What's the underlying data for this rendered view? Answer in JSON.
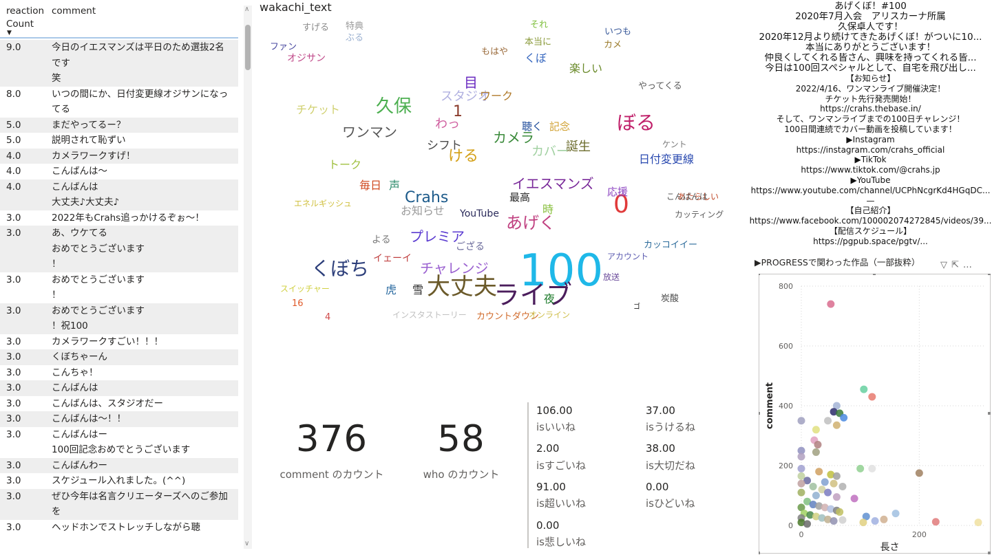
{
  "table": {
    "headers": {
      "reaction_count": "reaction Count",
      "comment": "comment"
    },
    "rows": [
      {
        "count": "9.0",
        "comment": "今日のイエスマンズは平日のため選抜2名です\n笑"
      },
      {
        "count": "8.0",
        "comment": "いつの間にか、日付変更線オジサンになってる"
      },
      {
        "count": "5.0",
        "comment": "まだやってるー？"
      },
      {
        "count": "5.0",
        "comment": "説明されて恥ずい"
      },
      {
        "count": "4.0",
        "comment": "カメラワークすげ！"
      },
      {
        "count": "4.0",
        "comment": "こんばんは〜"
      },
      {
        "count": "4.0",
        "comment": "こんばんは\n大丈夫♪大丈夫♪"
      },
      {
        "count": "3.0",
        "comment": "2022年もCrahs追っかけるぞぉ〜！"
      },
      {
        "count": "3.0",
        "comment": "あ、ウケてる\nおめでとうございます\n！"
      },
      {
        "count": "3.0",
        "comment": "おめでとうございます\n！"
      },
      {
        "count": "3.0",
        "comment": "おめでとうございます\n！祝100"
      },
      {
        "count": "3.0",
        "comment": "カメラワークすごい！！！"
      },
      {
        "count": "3.0",
        "comment": "くぼちゃーん"
      },
      {
        "count": "3.0",
        "comment": "こんちゃ！"
      },
      {
        "count": "3.0",
        "comment": "こんばんは"
      },
      {
        "count": "3.0",
        "comment": "こんばんは、スタジオだー"
      },
      {
        "count": "3.0",
        "comment": "こんばんは〜！！"
      },
      {
        "count": "3.0",
        "comment": "こんばんはー\n100回記念おめでとうございます"
      },
      {
        "count": "3.0",
        "comment": "こんばんわー"
      },
      {
        "count": "3.0",
        "comment": "スケジュール入れました。(^^)"
      },
      {
        "count": "3.0",
        "comment": "ぜひ今年は名言クリエーターズへのご参加を"
      },
      {
        "count": "3.0",
        "comment": "ヘッドホンでストレッチしながら聴"
      }
    ]
  },
  "wordcloud": {
    "title": "wakachi_text",
    "words": [
      {
        "text": "100",
        "color": "#1fb8e8",
        "size": 64
      },
      {
        "text": "ライブ",
        "color": "#4b1d5c",
        "size": 38
      },
      {
        "text": "大丈夫",
        "color": "#6b5a2a",
        "size": 34
      },
      {
        "text": "0",
        "color": "#e03a3a",
        "size": 36
      },
      {
        "text": "くぼち",
        "color": "#2c3e7a",
        "size": 28
      },
      {
        "text": "ぼる",
        "color": "#c0206a",
        "size": 28
      },
      {
        "text": "久保",
        "color": "#4caf50",
        "size": 26
      },
      {
        "text": "あげく",
        "color": "#c04080",
        "size": 24
      },
      {
        "text": "Crahs",
        "color": "#1c5a8a",
        "size": 22
      },
      {
        "text": "ける",
        "color": "#d4a017",
        "size": 22
      },
      {
        "text": "カメラ",
        "color": "#3a8a3a",
        "size": 20
      },
      {
        "text": "イエスマンズ",
        "color": "#7a2a9a",
        "size": 20
      },
      {
        "text": "プレミア",
        "color": "#5a3ad0",
        "size": 20
      },
      {
        "text": "チャレンジ",
        "color": "#9a60d0",
        "size": 20
      },
      {
        "text": "ワンマン",
        "color": "#555555",
        "size": 20
      },
      {
        "text": "1",
        "color": "#8a3a2a",
        "size": 22
      },
      {
        "text": "わっ",
        "color": "#d060a0",
        "size": 18
      },
      {
        "text": "目",
        "color": "#6a2ac0",
        "size": 20
      },
      {
        "text": "日付変更線",
        "color": "#2a4ab0",
        "size": 16
      },
      {
        "text": "スタジオ",
        "color": "#b0b0e0",
        "size": 18
      },
      {
        "text": "誕生",
        "color": "#6a6a2a",
        "size": 18
      },
      {
        "text": "カバー",
        "color": "#a0d0a0",
        "size": 18
      },
      {
        "text": "シフト",
        "color": "#4a4a4a",
        "size": 17
      },
      {
        "text": "チケット",
        "color": "#d0d070",
        "size": 16
      },
      {
        "text": "トーク",
        "color": "#a0c040",
        "size": 16
      },
      {
        "text": "毎日",
        "color": "#d04a20",
        "size": 16
      },
      {
        "text": "声",
        "color": "#2a8a6a",
        "size": 16
      },
      {
        "text": "お知らせ",
        "color": "#9a9a9a",
        "size": 16
      },
      {
        "text": "楽しい",
        "color": "#6a8a2a",
        "size": 16
      },
      {
        "text": "ワーク",
        "color": "#b07a2a",
        "size": 16
      },
      {
        "text": "聴く",
        "color": "#1c4a9a",
        "size": 15
      },
      {
        "text": "記念",
        "color": "#d0a030",
        "size": 15
      },
      {
        "text": "応援",
        "color": "#8a40c0",
        "size": 15
      },
      {
        "text": "最高",
        "color": "#2a2a2a",
        "size": 15
      },
      {
        "text": "時",
        "color": "#8ac040",
        "size": 16
      },
      {
        "text": "夜",
        "color": "#1c7a2a",
        "size": 16
      },
      {
        "text": "虎",
        "color": "#2a6aa0",
        "size": 16
      },
      {
        "text": "雪",
        "color": "#2a2a2a",
        "size": 16
      },
      {
        "text": "くぼ",
        "color": "#3a6ac0",
        "size": 16
      },
      {
        "text": "イェーイ",
        "color": "#c04040",
        "size": 14
      },
      {
        "text": "YouTube",
        "color": "#2a2a5a",
        "size": 14
      },
      {
        "text": "よる",
        "color": "#7a7a7a",
        "size": 14
      },
      {
        "text": "ござる",
        "color": "#6a6a9a",
        "size": 14
      },
      {
        "text": "カッコイイー",
        "color": "#2a6a9a",
        "size": 13
      },
      {
        "text": "カウントダウン",
        "color": "#d06a2a",
        "size": 13
      },
      {
        "text": "オジサン",
        "color": "#c04a8a",
        "size": 14
      },
      {
        "text": "ファン",
        "color": "#4a4aa0",
        "size": 13
      },
      {
        "text": "すげる",
        "color": "#8a8a8a",
        "size": 13
      },
      {
        "text": "特典",
        "color": "#9a9a9a",
        "size": 13
      },
      {
        "text": "ぶる",
        "color": "#9ab0d0",
        "size": 13
      },
      {
        "text": "それ",
        "color": "#80c040",
        "size": 13
      },
      {
        "text": "いつも",
        "color": "#3a5a9a",
        "size": 13
      },
      {
        "text": "カメ",
        "color": "#9a7a2a",
        "size": 13
      },
      {
        "text": "もはや",
        "color": "#9a6a3a",
        "size": 13
      },
      {
        "text": "本当に",
        "color": "#8a9a3a",
        "size": 13
      },
      {
        "text": "ケント",
        "color": "#7a7a7a",
        "size": 12
      },
      {
        "text": "エネルギッシュ",
        "color": "#d0c040",
        "size": 12
      },
      {
        "text": "スイッチャー",
        "color": "#d0d040",
        "size": 12
      },
      {
        "text": "インスタストーリー",
        "color": "#c0c0c0",
        "size": 12
      },
      {
        "text": "オンライン",
        "color": "#d0c050",
        "size": 12
      },
      {
        "text": "あたらしい",
        "color": "#c04a2a",
        "size": 12
      },
      {
        "text": "こんばんは",
        "color": "#5a5a5a",
        "size": 12
      },
      {
        "text": "カッティング",
        "color": "#5a5a5a",
        "size": 12
      },
      {
        "text": "やってくる",
        "color": "#5a5a5a",
        "size": 13
      },
      {
        "text": "アカウント",
        "color": "#5a5ab0",
        "size": 12
      },
      {
        "text": "放送",
        "color": "#6a4a9a",
        "size": 12
      },
      {
        "text": "炭酸",
        "color": "#4a4a4a",
        "size": 13
      },
      {
        "text": "16",
        "color": "#e05a2a",
        "size": 13
      },
      {
        "text": "4",
        "color": "#d04a4a",
        "size": 13
      },
      {
        "text": "ゴ",
        "color": "#1a1a1a",
        "size": 10
      }
    ]
  },
  "cards": {
    "comment_count": {
      "value": "376",
      "label": "comment のカウント"
    },
    "who_count": {
      "value": "58",
      "label": "who のカウント"
    }
  },
  "metrics": [
    {
      "value": "106.00",
      "label": "isいいね"
    },
    {
      "value": "37.00",
      "label": "isうけるね"
    },
    {
      "value": "2.00",
      "label": "isすごいね"
    },
    {
      "value": "38.00",
      "label": "is大切だね"
    },
    {
      "value": "91.00",
      "label": "is超いいね"
    },
    {
      "value": "0.00",
      "label": "isひどいね"
    },
    {
      "value": "0.00",
      "label": "is悲しいね"
    }
  ],
  "info": {
    "lines": [
      "あげくぼ！#100",
      "2020年7月入会　アリスカーナ所属",
      "久保卓人です！",
      "2020年12月より続けてきたあげくぼ！がついに10...",
      "本当にありがとうございます！",
      "仲良くしてくれる皆さん、興味を持ってくれる皆...",
      "今日は100回スペシャルとして、自宅を飛び出し...",
      "【お知らせ】",
      "2022/4/16、ワンマンライブ開催決定！",
      "チケット先行発売開始！",
      "https://crahs.thebase.in/",
      "そして、ワンマンライブまでの100日チャレンジ！",
      "100日間連続でカバー動画を投稿しています！",
      "▶Instagram",
      "https://instagram.com/crahs_official",
      "▶TikTok",
      "https://www.tiktok.com/@crahs.jp",
      "▶YouTube",
      "https://www.youtube.com/channel/UCPhNcgrKd4HGqDC...",
      "—",
      "【自己紹介】",
      "https://www.facebook.com/100002074272845/videos/39...",
      "【配信スケジュール】",
      "https://pgpub.space/pgtv/..."
    ]
  },
  "scatter": {
    "title": "▶PROGRESSで関わった作品（一部抜粋）",
    "chart_data": {
      "type": "scatter",
      "xlabel": "長さ",
      "ylabel": "comment",
      "xlim": [
        0,
        300
      ],
      "ylim": [
        0,
        800
      ],
      "x_ticks": [
        "0",
        "200"
      ],
      "y_ticks": [
        "0",
        "200",
        "400",
        "600",
        "800"
      ],
      "grid": true,
      "points": [
        {
          "x": 50,
          "y": 740,
          "color": "#d96c8e"
        },
        {
          "x": 106,
          "y": 455,
          "color": "#66d0a0"
        },
        {
          "x": 120,
          "y": 430,
          "color": "#e87a6e"
        },
        {
          "x": 60,
          "y": 400,
          "color": "#a3b4d6"
        },
        {
          "x": 55,
          "y": 380,
          "color": "#2c2c6a"
        },
        {
          "x": 65,
          "y": 375,
          "color": "#3a7a3a"
        },
        {
          "x": 72,
          "y": 360,
          "color": "#4a8ae0"
        },
        {
          "x": 45,
          "y": 350,
          "color": "#c0c0c0"
        },
        {
          "x": 0,
          "y": 350,
          "color": "#a0a0c0"
        },
        {
          "x": 60,
          "y": 335,
          "color": "#d0b070"
        },
        {
          "x": 25,
          "y": 320,
          "color": "#e0e080"
        },
        {
          "x": 22,
          "y": 285,
          "color": "#e0a0c0"
        },
        {
          "x": 28,
          "y": 270,
          "color": "#b08080"
        },
        {
          "x": 25,
          "y": 245,
          "color": "#a0a080"
        },
        {
          "x": 0,
          "y": 250,
          "color": "#9090c0"
        },
        {
          "x": 0,
          "y": 230,
          "color": "#b0a0c0"
        },
        {
          "x": 100,
          "y": 190,
          "color": "#90d090"
        },
        {
          "x": 120,
          "y": 190,
          "color": "#e0e0e0"
        },
        {
          "x": 200,
          "y": 175,
          "color": "#a08060"
        },
        {
          "x": 0,
          "y": 190,
          "color": "#a0a0d0"
        },
        {
          "x": 30,
          "y": 180,
          "color": "#d0a060"
        },
        {
          "x": 50,
          "y": 170,
          "color": "#c0c040"
        },
        {
          "x": 60,
          "y": 165,
          "color": "#a0a0a0"
        },
        {
          "x": 0,
          "y": 165,
          "color": "#c0d0a0"
        },
        {
          "x": 10,
          "y": 150,
          "color": "#6a6aa0"
        },
        {
          "x": 40,
          "y": 145,
          "color": "#80a0d0"
        },
        {
          "x": 55,
          "y": 140,
          "color": "#d0c080"
        },
        {
          "x": 70,
          "y": 130,
          "color": "#b0b0b0"
        },
        {
          "x": 20,
          "y": 130,
          "color": "#a0c0a0"
        },
        {
          "x": 0,
          "y": 140,
          "color": "#c0a0a0"
        },
        {
          "x": 35,
          "y": 120,
          "color": "#d0d0a0"
        },
        {
          "x": 45,
          "y": 110,
          "color": "#7a7ac0"
        },
        {
          "x": 90,
          "y": 90,
          "color": "#c070c0"
        },
        {
          "x": 25,
          "y": 100,
          "color": "#90b0d0"
        },
        {
          "x": 60,
          "y": 95,
          "color": "#c0a0c0"
        },
        {
          "x": 0,
          "y": 110,
          "color": "#a0b060"
        },
        {
          "x": 10,
          "y": 80,
          "color": "#80c080"
        },
        {
          "x": 20,
          "y": 70,
          "color": "#6080c0"
        },
        {
          "x": 30,
          "y": 65,
          "color": "#a0a0a0"
        },
        {
          "x": 40,
          "y": 60,
          "color": "#d0b0b0"
        },
        {
          "x": 50,
          "y": 55,
          "color": "#b0c0e0"
        },
        {
          "x": 60,
          "y": 50,
          "color": "#808080"
        },
        {
          "x": 65,
          "y": 45,
          "color": "#c0c060"
        },
        {
          "x": 0,
          "y": 60,
          "color": "#6a9a4a"
        },
        {
          "x": 5,
          "y": 40,
          "color": "#a0d060"
        },
        {
          "x": 15,
          "y": 35,
          "color": "#4a8a4a"
        },
        {
          "x": 25,
          "y": 30,
          "color": "#d0d080"
        },
        {
          "x": 35,
          "y": 25,
          "color": "#a0c0c0"
        },
        {
          "x": 45,
          "y": 20,
          "color": "#c0b090"
        },
        {
          "x": 55,
          "y": 15,
          "color": "#9090b0"
        },
        {
          "x": 70,
          "y": 18,
          "color": "#d0d0d0"
        },
        {
          "x": 110,
          "y": 30,
          "color": "#6090d0"
        },
        {
          "x": 125,
          "y": 15,
          "color": "#a0b0e0"
        },
        {
          "x": 140,
          "y": 20,
          "color": "#d0b090"
        },
        {
          "x": 160,
          "y": 40,
          "color": "#a0c0e0"
        },
        {
          "x": 105,
          "y": 10,
          "color": "#e0d080"
        },
        {
          "x": 0,
          "y": 25,
          "color": "#808080"
        },
        {
          "x": 0,
          "y": 10,
          "color": "#4a7a2a"
        },
        {
          "x": 10,
          "y": 5,
          "color": "#6a6a6a"
        },
        {
          "x": 228,
          "y": 12,
          "color": "#e07a7a"
        },
        {
          "x": 300,
          "y": 10,
          "color": "#f0e0a0"
        }
      ]
    }
  },
  "colors": {
    "header_underline": "#a9c8e8",
    "row_alt": "#eeeeee",
    "divider": "#c8c6c4"
  }
}
